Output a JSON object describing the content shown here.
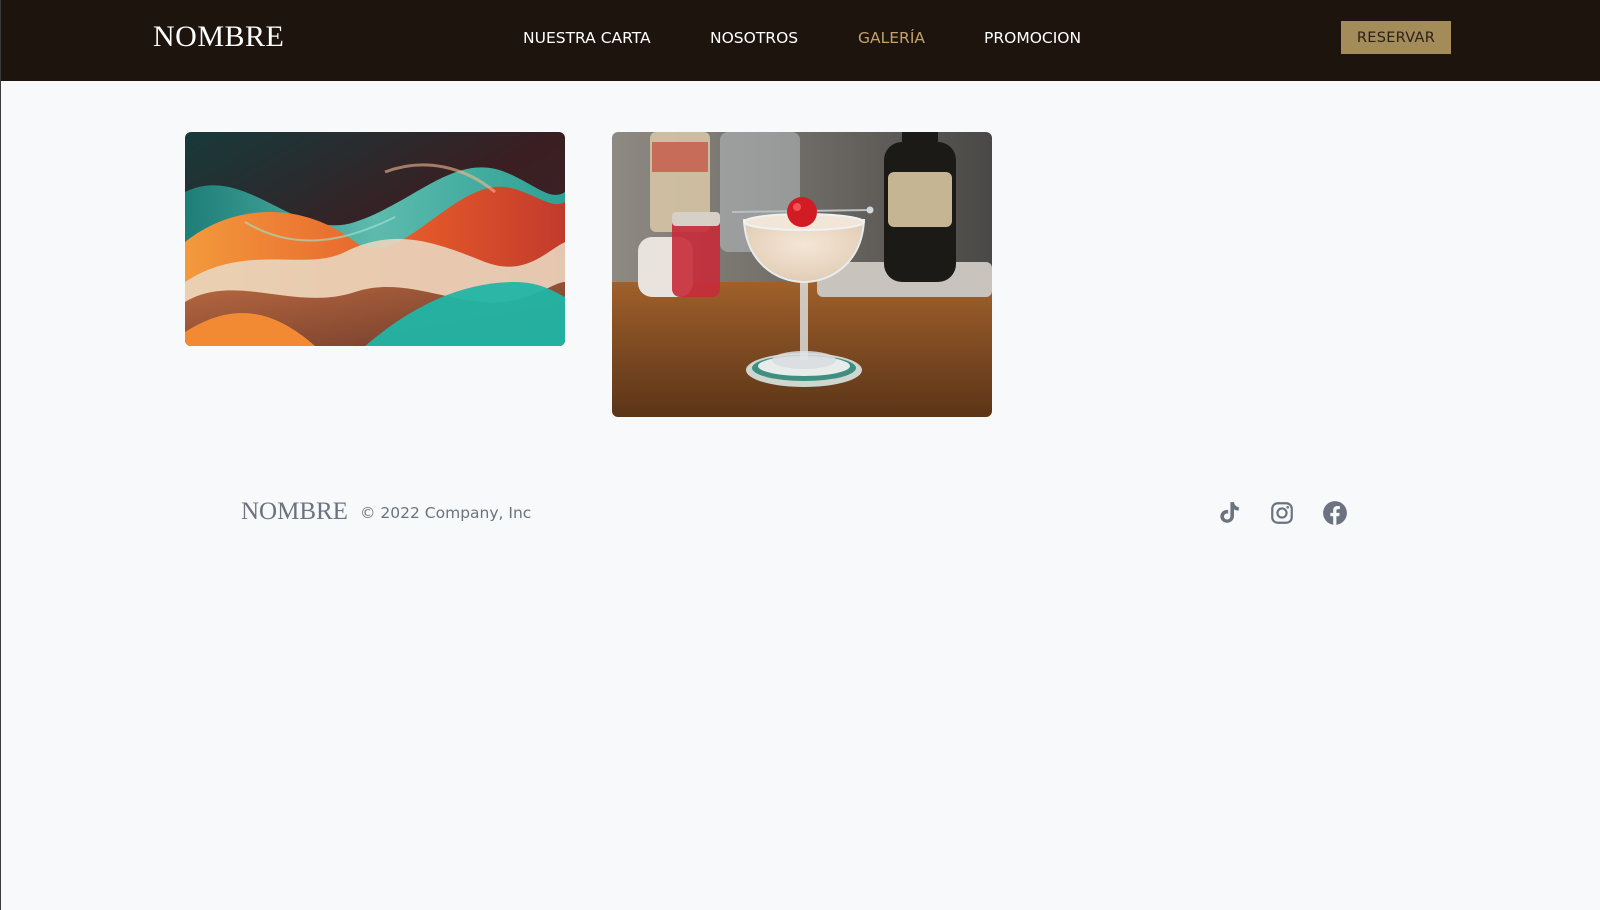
{
  "header": {
    "brand": "NOMBRE",
    "nav": [
      {
        "label": "NUESTRA CARTA",
        "active": false
      },
      {
        "label": "NOSOTROS",
        "active": false
      },
      {
        "label": "GALERÍA",
        "active": true
      },
      {
        "label": "PROMOCION",
        "active": false
      }
    ],
    "reserve_label": "RESERVAR"
  },
  "gallery": {
    "images": [
      {
        "name": "abstract-waves-image"
      },
      {
        "name": "cocktail-image"
      }
    ]
  },
  "footer": {
    "brand": "NOMBRE",
    "copyright": "© 2022 Company, Inc",
    "social": [
      "tiktok-icon",
      "instagram-icon",
      "facebook-icon"
    ]
  },
  "colors": {
    "header_bg": "#1e140e",
    "accent": "#c2a366",
    "button_bg": "#a38c59",
    "page_bg": "#f8f9fb",
    "muted_text": "#6b7280"
  }
}
